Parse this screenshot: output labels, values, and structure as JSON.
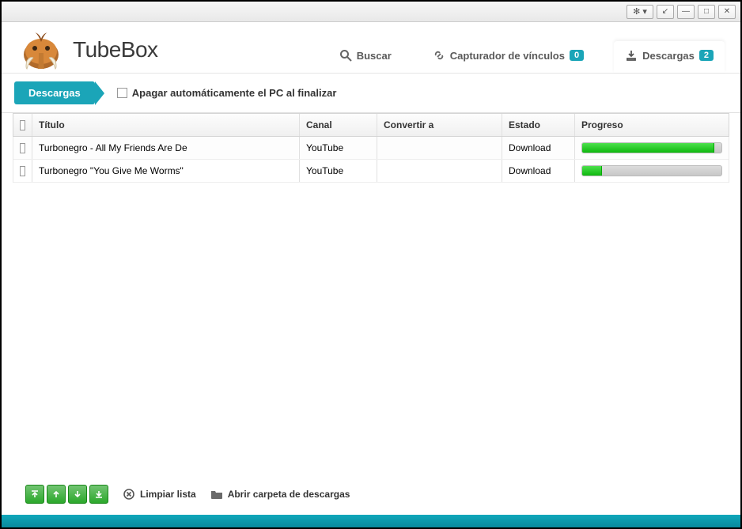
{
  "app": {
    "title": "TubeBox"
  },
  "window_buttons": {
    "gear": "✻ ▾",
    "shrink": "↙",
    "min": "—",
    "max": "□",
    "close": "✕"
  },
  "tabs": {
    "search": {
      "label": "Buscar"
    },
    "links": {
      "label": "Capturador de vínculos",
      "badge": "0"
    },
    "downloads": {
      "label": "Descargas",
      "badge": "2"
    }
  },
  "toolbar": {
    "pill": "Descargas",
    "auto_shutdown_label": "Apagar automáticamente el PC al finalizar"
  },
  "columns": {
    "titulo": "Título",
    "canal": "Canal",
    "convertir": "Convertir a",
    "estado": "Estado",
    "progreso": "Progreso"
  },
  "rows": [
    {
      "titulo": "Turbonegro - All My Friends Are De",
      "canal": "YouTube",
      "convertir": "",
      "estado": "Download",
      "progress": 95
    },
    {
      "titulo": "Turbonegro \"You Give Me Worms\"",
      "canal": "YouTube",
      "convertir": "",
      "estado": "Download",
      "progress": 14
    }
  ],
  "footer": {
    "clear_label": "Limpiar lista",
    "open_folder_label": "Abrir carpeta de descargas"
  }
}
